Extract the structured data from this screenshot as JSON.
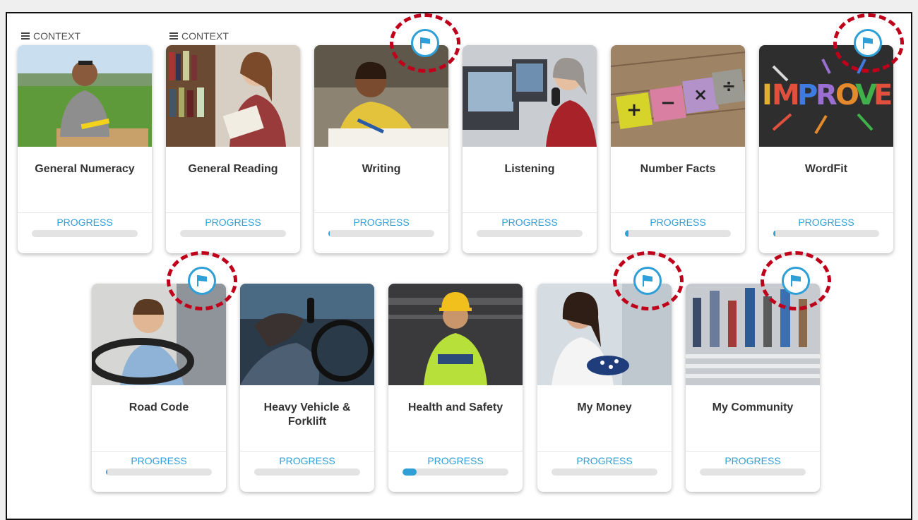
{
  "context_label": "CONTEXT",
  "progress_label": "PROGRESS",
  "colors": {
    "accent": "#2f9fd8",
    "highlight": "#c0001a",
    "bar_track": "#e3e3e3"
  },
  "modules": [
    {
      "title": "General Numeracy",
      "progress": 0.0,
      "flag": false,
      "context": true,
      "photo": "man-in-field"
    },
    {
      "title": "General Reading",
      "progress": 0.0,
      "flag": false,
      "context": true,
      "photo": "woman-reading-library"
    },
    {
      "title": "Writing",
      "progress": 0.01,
      "flag": true,
      "context": false,
      "photo": "man-writing"
    },
    {
      "title": "Listening",
      "progress": 0.0,
      "flag": false,
      "context": false,
      "photo": "woman-on-phone-computers"
    },
    {
      "title": "Number Facts",
      "progress": 0.03,
      "flag": false,
      "context": false,
      "photo": "math-blocks"
    },
    {
      "title": "WordFit",
      "progress": 0.02,
      "flag": true,
      "context": false,
      "photo": "improve-word"
    },
    {
      "title": "Road Code",
      "progress": 0.01,
      "flag": true,
      "context": false,
      "photo": "man-driving"
    },
    {
      "title": "Heavy Vehicle & Forklift",
      "progress": 0.0,
      "flag": false,
      "context": false,
      "photo": "truck-driver-radio"
    },
    {
      "title": "Health and Safety",
      "progress": 0.13,
      "flag": false,
      "context": false,
      "photo": "worker-hardhat"
    },
    {
      "title": "My Money",
      "progress": 0.0,
      "flag": true,
      "context": false,
      "photo": "woman-with-purse"
    },
    {
      "title": "My Community",
      "progress": 0.0,
      "flag": true,
      "context": false,
      "photo": "crowd-crossing"
    }
  ]
}
